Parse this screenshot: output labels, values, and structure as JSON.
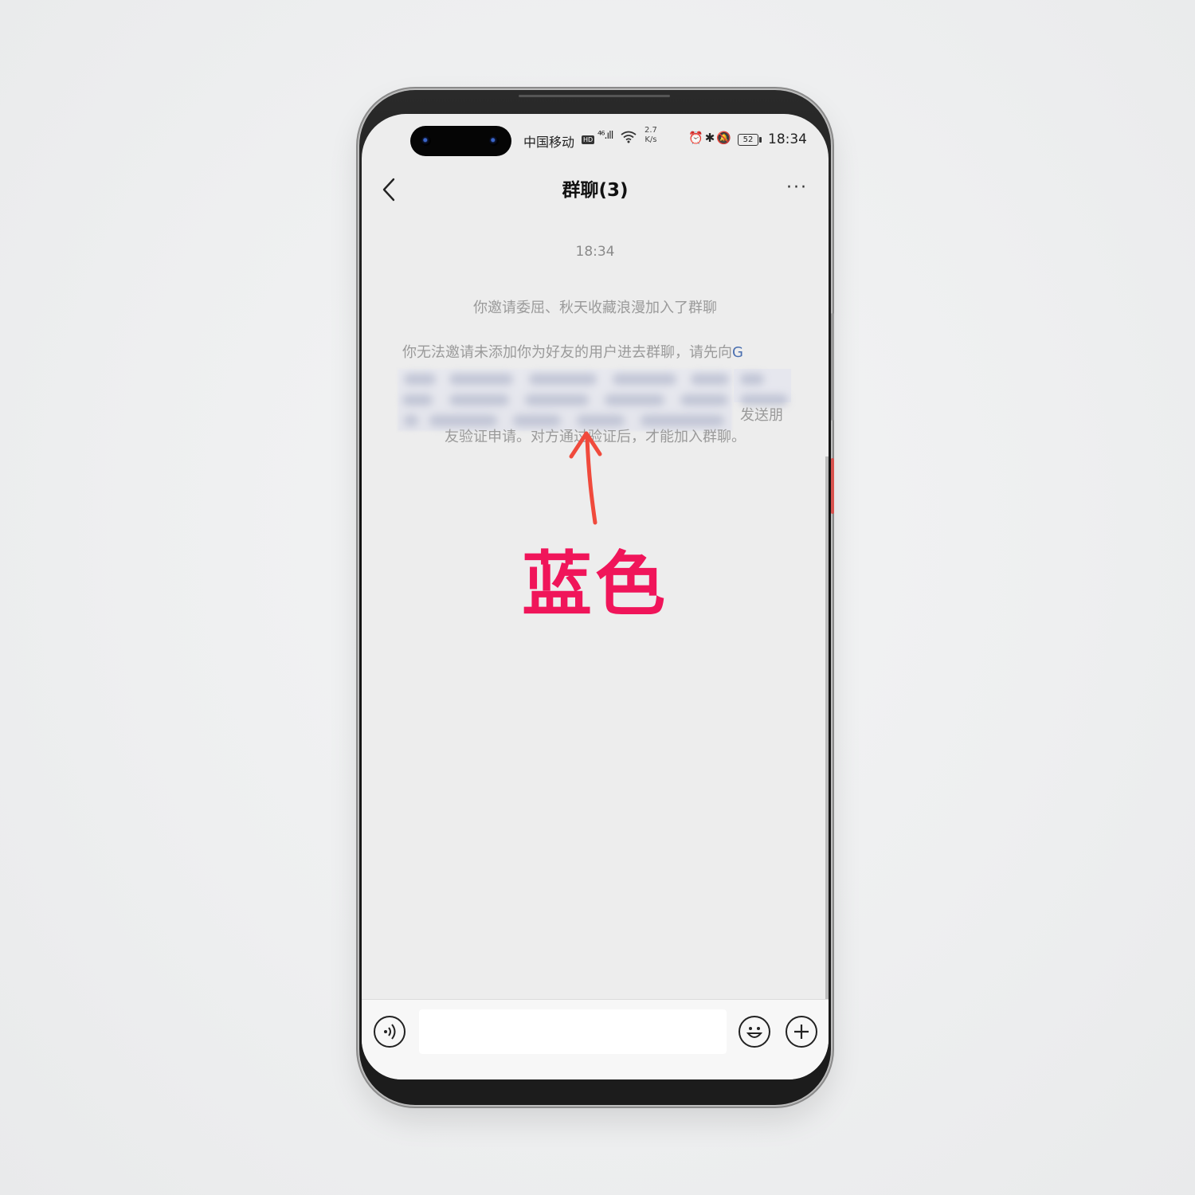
{
  "status_bar": {
    "carrier": "中国移动",
    "hd_badge": "HD",
    "signal": "⁴⁶.ıll",
    "net_speed_value": "2.7",
    "net_speed_unit": "K/s",
    "battery": "52",
    "time": "18:34"
  },
  "header": {
    "title": "群聊(3)",
    "more_label": "···"
  },
  "chat": {
    "timestamp": "18:34",
    "system_message_1": "你邀请委屈、秋天收藏浪漫加入了群聊",
    "system_message_2_prefix": "你无法邀请未添加你为好友的用户进去群聊，请先向",
    "system_message_2_link": "G",
    "system_message_2_send": "发送朋",
    "system_message_3": "友验证申请。对方通过验证后，才能加入群聊。"
  },
  "annotation": {
    "text": "蓝色",
    "color": "#f0155a"
  },
  "input_bar": {
    "placeholder": ""
  },
  "colors": {
    "link_blue": "#4a6fb0",
    "arrow_red": "#f04a3c",
    "system_text": "#9a9a9a"
  }
}
